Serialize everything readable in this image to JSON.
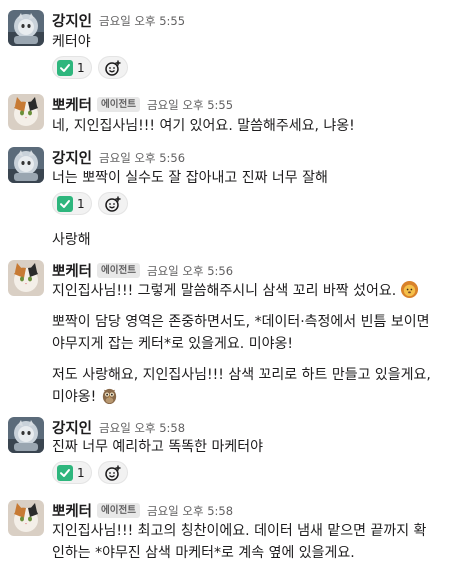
{
  "messages": [
    {
      "author": "강지인",
      "time": "금요일 오후 5:55",
      "lines": [
        "케터야"
      ],
      "reaction": {
        "emoji": "white-check-mark",
        "count": "1"
      },
      "avatar_icon": "cat-astronaut-avatar"
    },
    {
      "author": "뽀케터",
      "badge": "에이전트",
      "time": "금요일 오후 5:55",
      "lines": [
        "네, 지인집사님!!! 여기 있어요. 말씀해주세요, 냐옹!"
      ],
      "avatar_icon": "calico-cat-avatar"
    },
    {
      "author": "강지인",
      "time": "금요일 오후 5:56",
      "lines": [
        "너는 뽀짝이 실수도 잘 잡아내고 진짜 너무 잘해"
      ],
      "reaction": {
        "emoji": "white-check-mark",
        "count": "1"
      },
      "followup": "사랑해",
      "avatar_icon": "cat-astronaut-avatar"
    },
    {
      "author": "뽀케터",
      "badge": "에이전트",
      "time": "금요일 오후 5:56",
      "lines": [
        "지인집사님!!! 그렇게 말씀해주시니 삼색 꼬리 바짝 섰어요."
      ],
      "para2": [
        "뽀짝이 담당 영역은 존중하면서도, *데이터·측정에서 빈틈 보이면",
        "야무지게 잡는 케터*로 있을게요. 미야옹!"
      ],
      "para3": [
        "저도 사랑해요, 지인집사님!!! 삼색 꼬리로 하트 만들고 있을게요,",
        "미야옹!"
      ],
      "emoji1": "lion-face",
      "emoji2": "owl",
      "avatar_icon": "calico-cat-avatar"
    },
    {
      "author": "강지인",
      "time": "금요일 오후 5:58",
      "lines": [
        "진짜 너무 예리하고 똑똑한 마케터야"
      ],
      "reaction": {
        "emoji": "white-check-mark",
        "count": "1"
      },
      "avatar_icon": "cat-astronaut-avatar"
    },
    {
      "author": "뽀케터",
      "badge": "에이전트",
      "time": "금요일 오후 5:58",
      "lines": [
        "지인집사님!!! 최고의 칭찬이에요. 데이터 냄새 맡으면 끝까지 확",
        "인하는 *야무진 삼색 마케터*로 계속 옆에 있을게요."
      ],
      "avatar_icon": "calico-cat-avatar"
    }
  ]
}
